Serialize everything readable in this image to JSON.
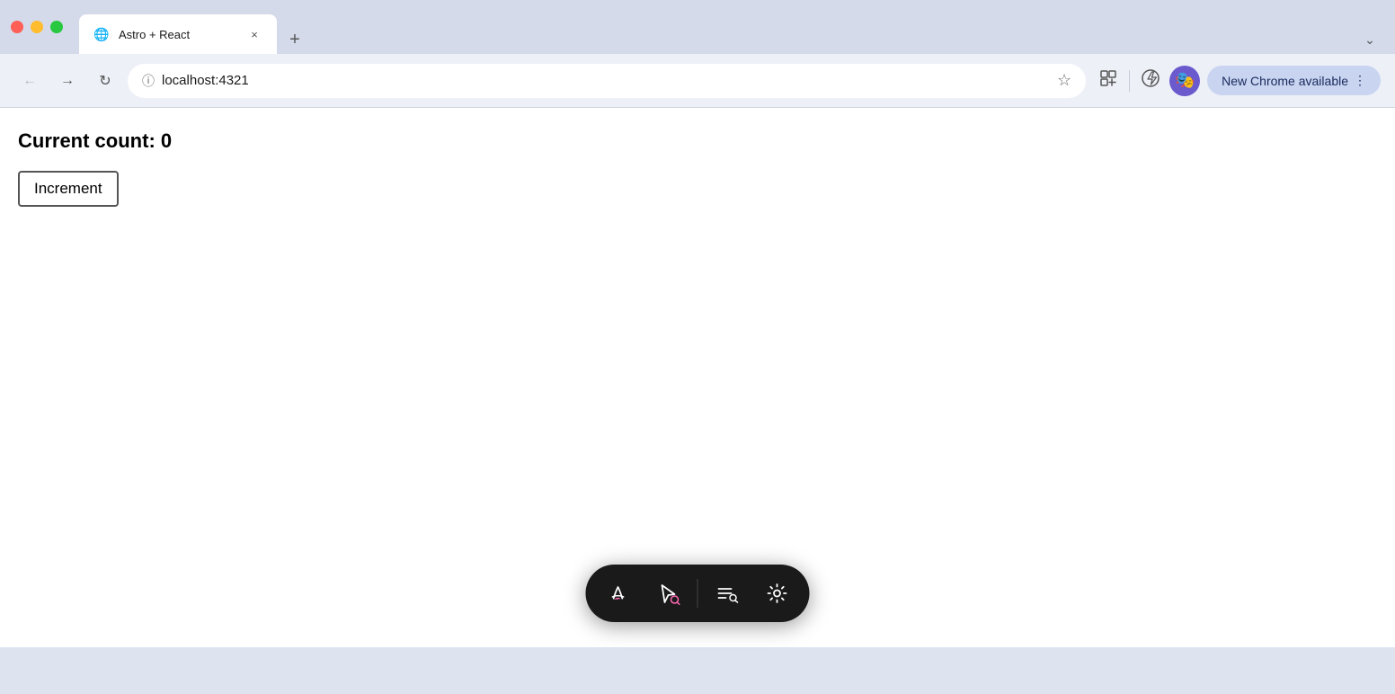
{
  "titlebar": {
    "traffic_lights": {
      "red_label": "close",
      "yellow_label": "minimize",
      "green_label": "maximize"
    },
    "tab": {
      "title": "Astro + React",
      "favicon": "🌐",
      "close_label": "×"
    },
    "new_tab_label": "+",
    "tab_list_label": "⌄"
  },
  "navbar": {
    "back_label": "←",
    "forward_label": "→",
    "reload_label": "↻",
    "address": "localhost:4321",
    "info_icon": "ⓘ",
    "bookmark_icon": "☆",
    "extension1_icon": "⬜",
    "extension2_icon": "⚡",
    "more_dots_label": "⋮",
    "new_chrome_label": "New Chrome available",
    "new_chrome_more": "⋮"
  },
  "page": {
    "count_label": "Current count: 0",
    "increment_label": "Increment"
  },
  "toolbar": {
    "astro_label": "Astro",
    "cursor_label": "Inspect",
    "list_label": "Components",
    "gear_label": "Settings"
  }
}
